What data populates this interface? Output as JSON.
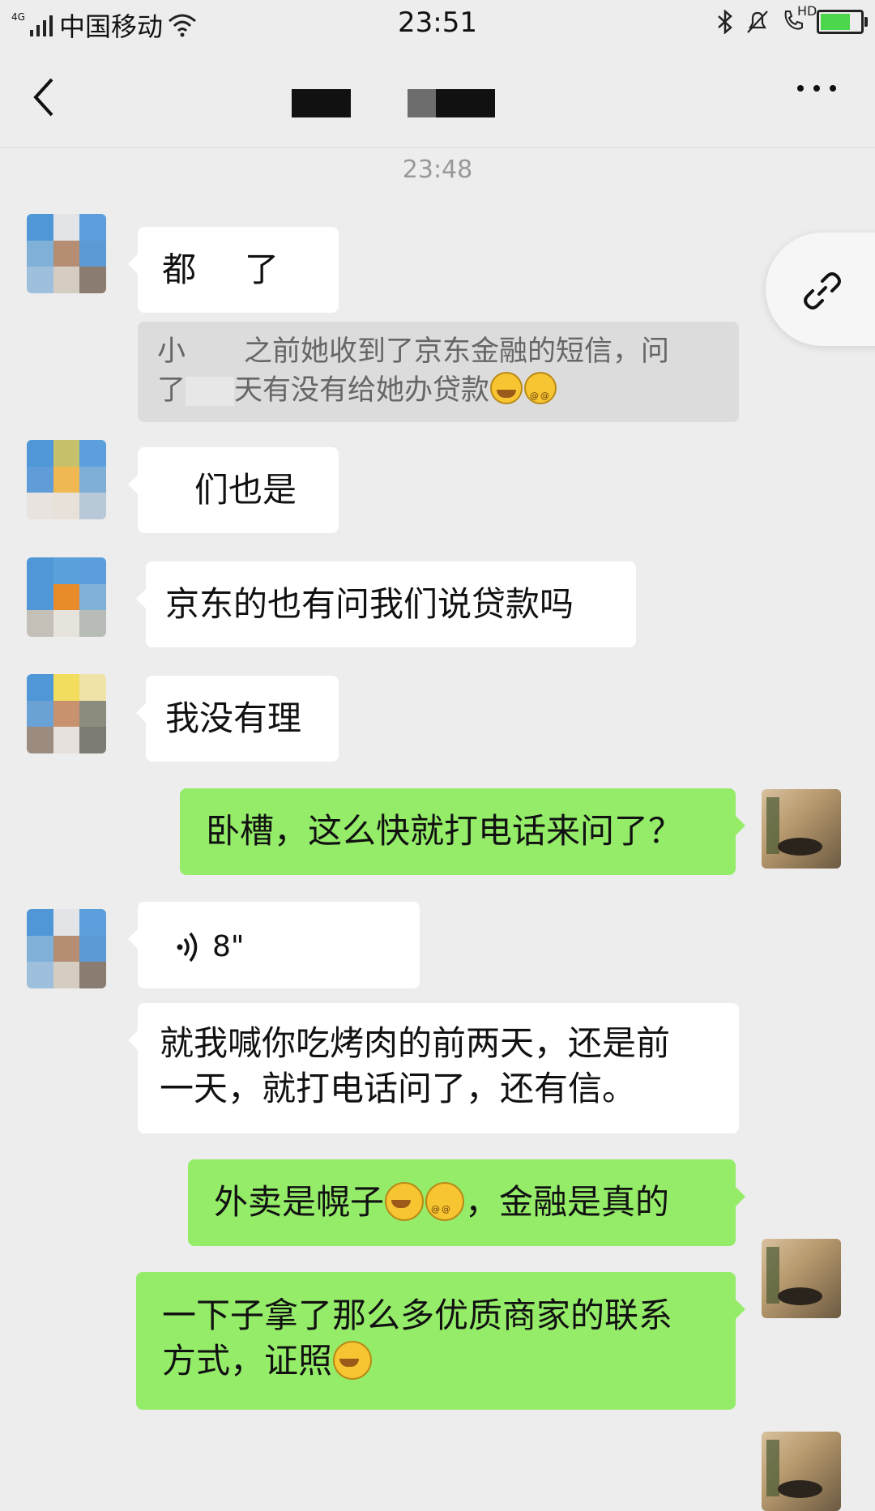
{
  "status_bar": {
    "network_type": "4G",
    "carrier": "中国移动",
    "time": "23:51",
    "hd_label": "HD"
  },
  "nav": {
    "back_icon": "chevron-left-icon",
    "more_icon": "more-icon"
  },
  "timestamp": "23:48",
  "messages": [
    {
      "side": "in",
      "text_a": "都",
      "text_b": "了"
    },
    {
      "side": "in",
      "quote_line1_a": "小",
      "quote_line1_b": "之前她收到了京东金融的短信，问",
      "quote_line2_a": "了",
      "quote_line2_b": "天有没有给她办贷款"
    },
    {
      "side": "in",
      "text": "们也是"
    },
    {
      "side": "in",
      "text": "京东的也有问我们说贷款吗"
    },
    {
      "side": "in",
      "text": "我没有理"
    },
    {
      "side": "out",
      "text": "卧槽，这么快就打电话来问了？"
    },
    {
      "side": "in",
      "voice_duration": "8\""
    },
    {
      "side": "in",
      "text_line1": "就我喊你吃烤肉的前两天，还是前",
      "text_line2": "一天，就打电话问了，还有信。"
    },
    {
      "side": "out",
      "text_a": "外卖是幌子",
      "text_b": "，金融是真的"
    },
    {
      "side": "out",
      "text_line1": "一下子拿了那么多优质商家的联系",
      "text_line2": "方式，证照"
    }
  ],
  "colors": {
    "background": "#ededed",
    "bubble_out": "#95ec69",
    "bubble_in": "#ffffff"
  }
}
